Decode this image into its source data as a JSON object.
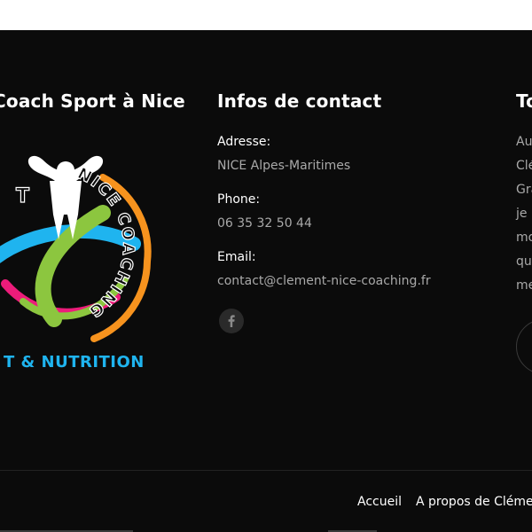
{
  "footer": {
    "col1": {
      "heading": "Coach Sport à Nice",
      "logo": {
        "ring_text": "NICE COACHING",
        "bottom_text": "T & NUTRITION",
        "top_text": "T"
      }
    },
    "col2": {
      "heading": "Infos de contact",
      "address_label": "Adresse:",
      "address_value": "NICE Alpes-Maritimes",
      "phone_label": "Phone:",
      "phone_value": "06 35 32 50 44",
      "email_label": "Email:",
      "email_value": "contact@clement-nice-coaching.fr",
      "social_icon": "facebook-icon"
    },
    "col3": {
      "heading": "To",
      "lines": [
        "Au",
        "Clé",
        "Gra",
        "je",
        "mo",
        "qu",
        "me"
      ]
    }
  },
  "bottom_nav": {
    "links": [
      "Accueil",
      "A propos de Clément"
    ]
  },
  "colors": {
    "background": "#0b0b0b",
    "heading": "#ffffff",
    "muted_text": "#a9a9a9",
    "logo_blue": "#1fb4ef",
    "logo_green": "#8cc63f",
    "logo_orange": "#f7931e",
    "logo_pink": "#ec1c7a"
  }
}
